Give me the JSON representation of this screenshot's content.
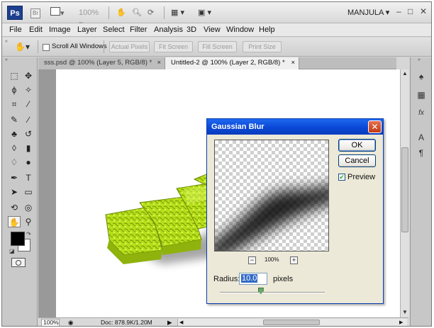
{
  "app": {
    "logo": "Ps",
    "zoom_menu": "100%",
    "user": "MANJULA",
    "min_label": "–",
    "max_label": "□",
    "close_label": "✕"
  },
  "menu": [
    "File",
    "Edit",
    "Image",
    "Layer",
    "Select",
    "Filter",
    "Analysis",
    "3D",
    "View",
    "Window",
    "Help"
  ],
  "options": {
    "scroll_all_windows": "Scroll All Windows",
    "scroll_all_checked": false,
    "buttons": [
      "Actual Pixels",
      "Fit Screen",
      "Fill Screen",
      "Print Size"
    ]
  },
  "tabs": [
    {
      "label": "sss.psd @ 100% (Layer 5, RGB/8) *",
      "active": false
    },
    {
      "label": "Untitled-2 @ 100% (Layer 2, RGB/8) *",
      "active": true
    }
  ],
  "canvas_art": {
    "text": "WORD",
    "color": "#b6df1a"
  },
  "status": {
    "zoom": "100%",
    "doc_info": "Doc: 878.9K/1.20M"
  },
  "dialog": {
    "title": "Gaussian Blur",
    "ok": "OK",
    "cancel": "Cancel",
    "preview_label": "Preview",
    "preview_checked": true,
    "zoom_percent": "100%",
    "zoom_minus": "−",
    "zoom_plus": "+",
    "radius_label": "Radius:",
    "radius_value": "10.0",
    "radius_unit": "pixels",
    "radius_slider_fraction": 0.39
  },
  "colors": {
    "accent_title": "#0a48d6",
    "foreground_swatch": "#000000",
    "background_swatch": "#ffffff",
    "art_green": "#b6df1a"
  }
}
